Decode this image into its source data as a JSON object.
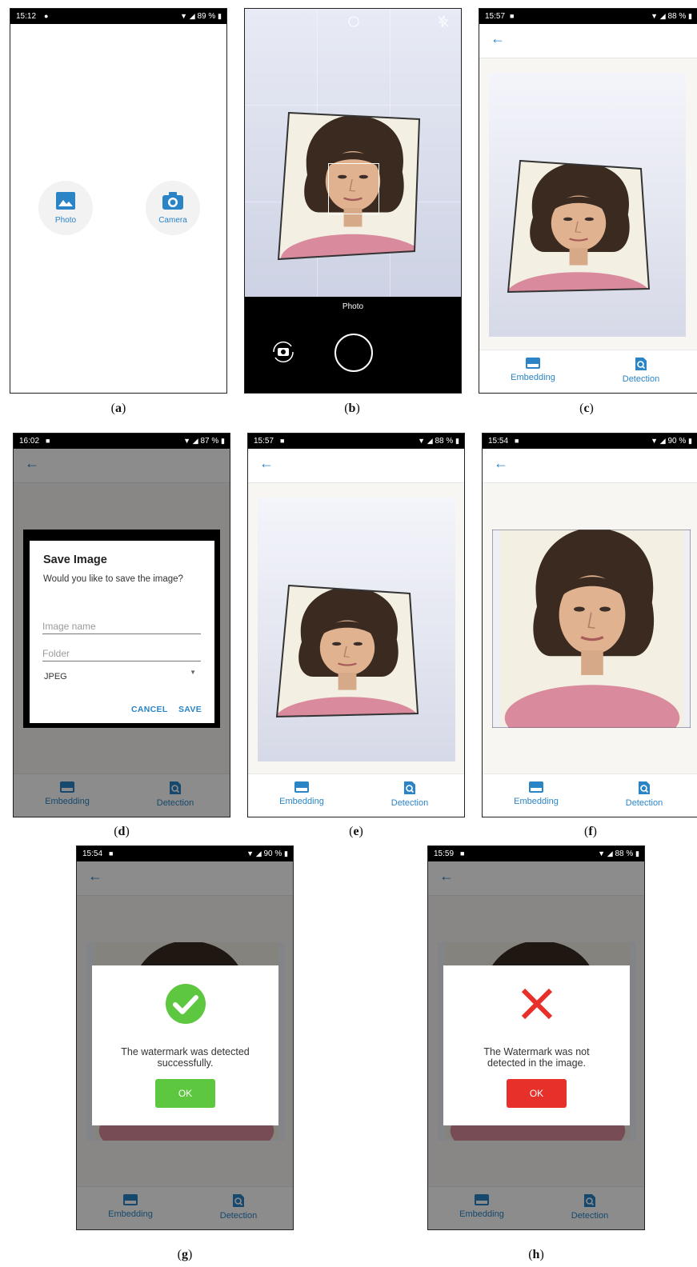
{
  "captions": {
    "a": "a",
    "b": "b",
    "c": "c",
    "d": "d",
    "e": "e",
    "f": "f",
    "g": "g",
    "h": "h"
  },
  "panel_a": {
    "status_time": "15:12",
    "battery": "89 %",
    "photo_label": "Photo",
    "camera_label": "Camera"
  },
  "panel_b": {
    "mode_label": "Photo"
  },
  "panel_c": {
    "status_time": "15:57",
    "battery": "88 %",
    "nav_embedding": "Embedding",
    "nav_detection": "Detection"
  },
  "panel_d": {
    "status_time": "16:02",
    "battery": "87 %",
    "dialog_title": "Save Image",
    "dialog_message": "Would you like to save the image?",
    "image_name_placeholder": "Image name",
    "folder_placeholder": "Folder",
    "format_value": "JPEG",
    "cancel_label": "CANCEL",
    "save_label": "SAVE",
    "nav_embedding": "Embedding",
    "nav_detection": "Detection"
  },
  "panel_e": {
    "status_time": "15:57",
    "battery": "88 %",
    "nav_embedding": "Embedding",
    "nav_detection": "Detection"
  },
  "panel_f": {
    "status_time": "15:54",
    "battery": "90 %",
    "nav_embedding": "Embedding",
    "nav_detection": "Detection"
  },
  "panel_g": {
    "status_time": "15:54",
    "battery": "90 %",
    "message_line1": "The watermark was detected",
    "message_line2": "successfully.",
    "ok_label": "OK",
    "ok_color": "#5cc73f",
    "icon": "check-circle-icon",
    "nav_embedding": "Embedding",
    "nav_detection": "Detection"
  },
  "panel_h": {
    "status_time": "15:59",
    "battery": "88 %",
    "message_line1": "The Watermark was not",
    "message_line2": "detected in the image.",
    "ok_label": "OK",
    "ok_color": "#e8302a",
    "icon": "x-mark-icon",
    "nav_embedding": "Embedding",
    "nav_detection": "Detection"
  },
  "colors": {
    "accent": "#2a84c6"
  }
}
